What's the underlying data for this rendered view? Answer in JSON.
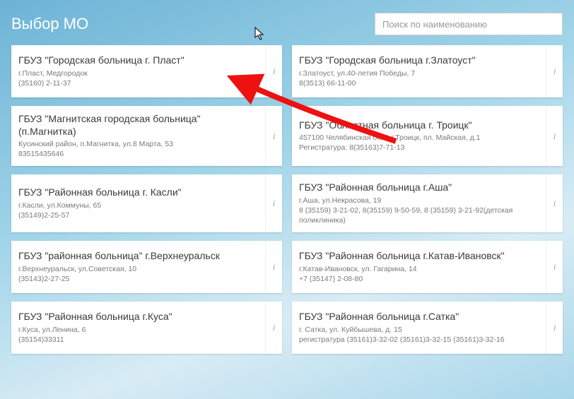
{
  "header": {
    "title": "Выбор МО",
    "search_placeholder": "Поиск по наименованию"
  },
  "cards": [
    {
      "title": "ГБУЗ \"Городская больница г. Пласт\"",
      "lines": [
        "г.Пласт, Медгородок",
        "(35160) 2-11-37"
      ]
    },
    {
      "title": "ГБУЗ \"Городская больница г.Златоуст\"",
      "lines": [
        "г.Златоуст, ул.40-летия Победы, 7",
        "8(3513) 66-11-00"
      ]
    },
    {
      "title": "ГБУЗ \"Магнитская городская больница\" (п.Магнитка)",
      "lines": [
        "Кусинский район, п.Магнитка, ул.8 Марта, 53",
        "83515435646"
      ]
    },
    {
      "title": "ГБУЗ \"Областная больница г. Троицк\"",
      "lines": [
        "457100 Челябинская обл., г.Троицк, пл. Майская, д.1",
        "Регистратура: 8(35163)7-71-13"
      ]
    },
    {
      "title": "ГБУЗ \"Районная больница г. Касли\"",
      "lines": [
        "г.Касли, ул.Коммуны, 65",
        "(35149)2-25-57"
      ]
    },
    {
      "title": "ГБУЗ \"Районная больница г.Аша\"",
      "lines": [
        "г.Аша, ул.Некрасова, 19",
        "8 (35159) 3-21-02, 8(35159) 9-50-59, 8 (35159) 3-21-92(детская поликлиника)"
      ]
    },
    {
      "title": "ГБУЗ \"районная больница\" г.Верхнеуральск",
      "lines": [
        "г.Верхнеуральск, ул.Советская, 10",
        "(35143)2-27-25"
      ]
    },
    {
      "title": "ГБУЗ \"Районная больница г.Катав-Ивановск\"",
      "lines": [
        "г.Катав-Ивановск, ул. Гагарина, 14",
        "+7 (35147) 2-08-80"
      ]
    },
    {
      "title": "ГБУЗ \"Районная больница г.Куса\"",
      "lines": [
        "г.Куса, ул.Ленина, 6",
        "(35154)33311"
      ]
    },
    {
      "title": "ГБУЗ \"Районная больница г.Сатка\"",
      "lines": [
        "г. Сатка, ул. Куйбышева, д. 15",
        "регистратура (35161)3-32-02 (35161)3-32-15 (35161)3-32-16"
      ]
    }
  ],
  "icons": {
    "info": "i"
  }
}
